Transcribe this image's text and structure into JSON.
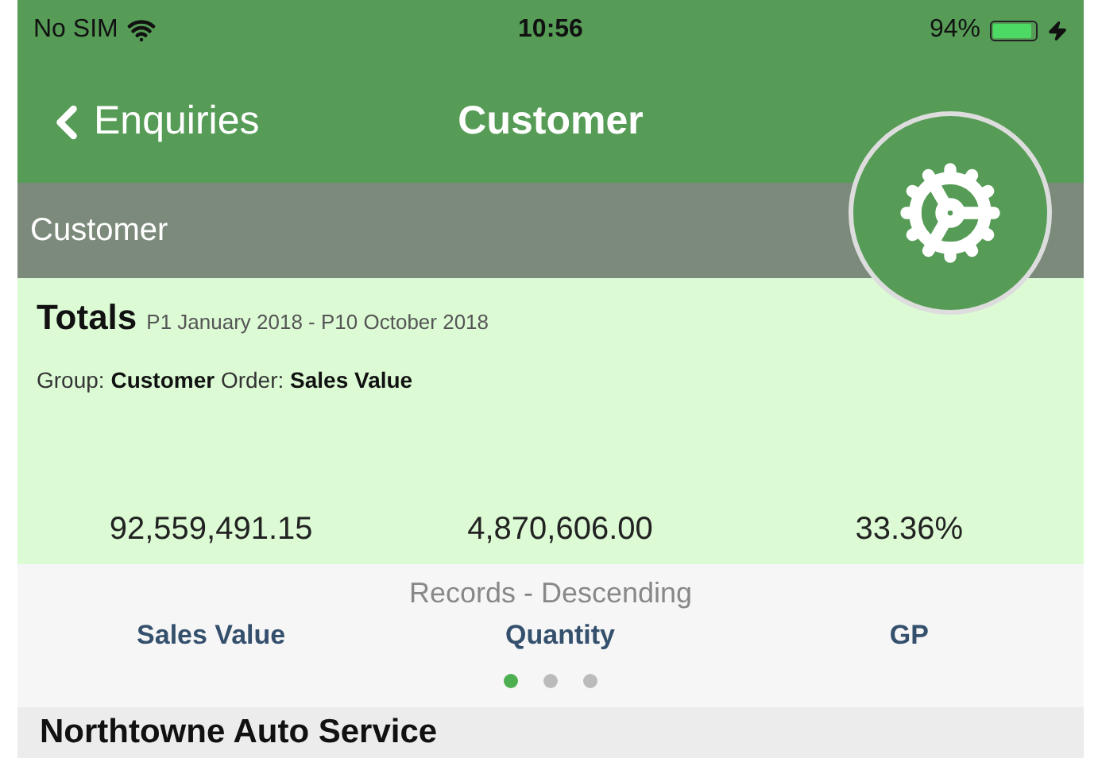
{
  "status_bar": {
    "carrier": "No SIM",
    "time": "10:56",
    "battery": "94%"
  },
  "nav_bar": {
    "back_label": "Enquiries",
    "title": "Customer"
  },
  "section_header": "Customer",
  "totals": {
    "title": "Totals",
    "period": "P1 January 2018 - P10 October 2018",
    "summary": "Group: **Customer** Order: **Sales Value**",
    "values": [
      "92,559,491.15",
      "4,870,606.00",
      "33.36%"
    ]
  },
  "records": {
    "title": "Records - Descending",
    "columns": [
      "Sales Value",
      "Quantity",
      "GP"
    ],
    "pages": [
      {
        "selected": true
      },
      {
        "selected": false
      },
      {
        "selected": false
      }
    ]
  },
  "list": [
    {
      "name": "Northtowne Auto Service"
    }
  ]
}
